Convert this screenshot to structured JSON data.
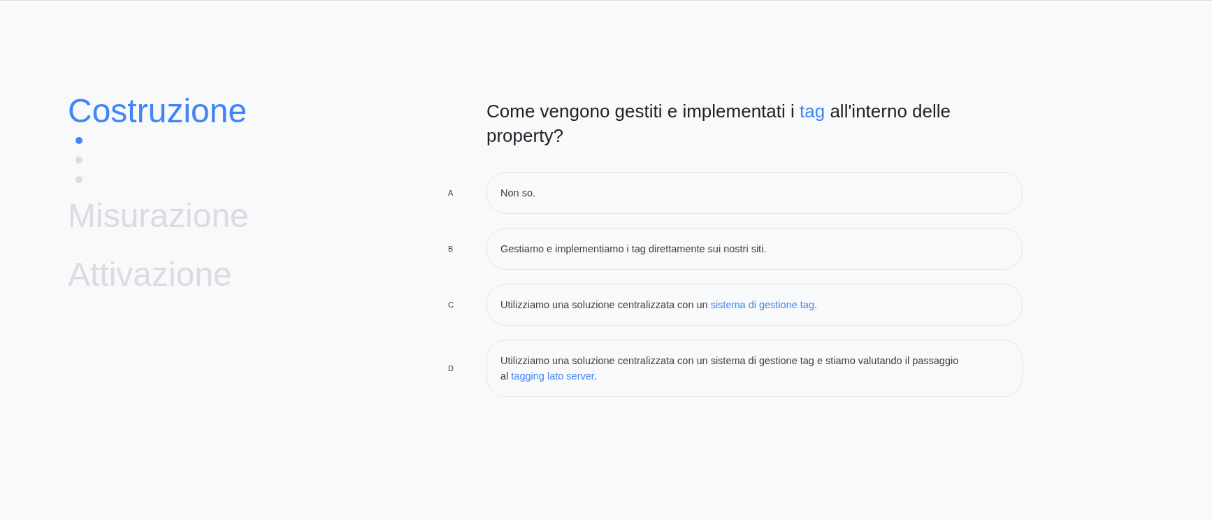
{
  "sections": [
    {
      "label": "Costruzione",
      "selected": true,
      "steps": [
        {
          "selected": true
        },
        {
          "selected": false
        },
        {
          "selected": false
        }
      ]
    },
    {
      "label": "Misurazione",
      "selected": false
    },
    {
      "label": "Attivazione",
      "selected": false
    }
  ],
  "question": [
    {
      "kind": "text",
      "text": "Come vengono gestiti e implementati i "
    },
    {
      "kind": "link",
      "text": "tag"
    },
    {
      "kind": "text",
      "text": " all'interno delle property?"
    }
  ],
  "options": [
    {
      "letter": "A",
      "parts": [
        {
          "kind": "text",
          "text": "Non so."
        }
      ]
    },
    {
      "letter": "B",
      "parts": [
        {
          "kind": "text",
          "text": "Gestiamo e implementiamo i tag direttamente sui nostri siti."
        }
      ]
    },
    {
      "letter": "C",
      "parts": [
        {
          "kind": "text",
          "text": "Utilizziamo una soluzione centralizzata con un "
        },
        {
          "kind": "link",
          "text": "sistema di gestione tag"
        },
        {
          "kind": "text",
          "text": "."
        }
      ]
    },
    {
      "letter": "D",
      "parts": [
        {
          "kind": "text",
          "text": "Utilizziamo una soluzione centralizzata con un sistema di gestione tag e stiamo valutando il passaggio al "
        },
        {
          "kind": "link",
          "text": "tagging lato server"
        },
        {
          "kind": "text",
          "text": "."
        }
      ]
    }
  ]
}
